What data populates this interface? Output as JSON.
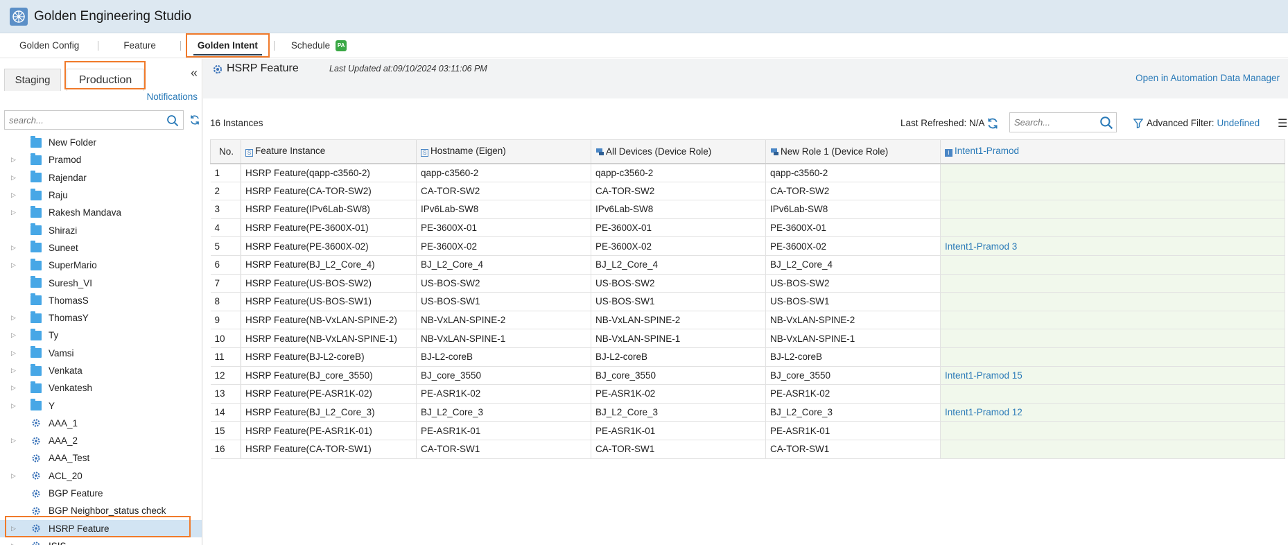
{
  "app": {
    "title": "Golden Engineering Studio"
  },
  "nav": {
    "tabs": [
      {
        "label": "Golden Config"
      },
      {
        "label": "Feature"
      },
      {
        "label": "Golden Intent",
        "active": true
      },
      {
        "label": "Schedule",
        "badge": "PA"
      }
    ]
  },
  "left": {
    "tabs": [
      {
        "label": "Staging"
      },
      {
        "label": "Production",
        "active": true
      }
    ],
    "notifications": "Notifications",
    "search_placeholder": "search...",
    "tree": [
      {
        "label": "New Folder",
        "icon": "folder-icon",
        "expandable": false
      },
      {
        "label": "Pramod",
        "icon": "folder-icon",
        "expandable": true
      },
      {
        "label": "Rajendar",
        "icon": "folder-icon",
        "expandable": true
      },
      {
        "label": "Raju",
        "icon": "folder-icon",
        "expandable": true
      },
      {
        "label": "Rakesh Mandava",
        "icon": "folder-icon",
        "expandable": true
      },
      {
        "label": "Shirazi",
        "icon": "folder-icon",
        "expandable": false
      },
      {
        "label": "Suneet",
        "icon": "folder-icon",
        "expandable": true
      },
      {
        "label": "SuperMario",
        "icon": "folder-icon",
        "expandable": true
      },
      {
        "label": "Suresh_VI",
        "icon": "folder-icon",
        "expandable": false
      },
      {
        "label": "ThomasS",
        "icon": "folder-icon",
        "expandable": false
      },
      {
        "label": "ThomasY",
        "icon": "folder-icon",
        "expandable": true
      },
      {
        "label": "Ty",
        "icon": "folder-icon",
        "expandable": true
      },
      {
        "label": "Vamsi",
        "icon": "folder-icon",
        "expandable": true
      },
      {
        "label": "Venkata",
        "icon": "folder-icon",
        "expandable": true
      },
      {
        "label": "Venkatesh",
        "icon": "folder-icon",
        "expandable": true
      },
      {
        "label": "Y",
        "icon": "folder-icon",
        "expandable": true
      },
      {
        "label": "AAA_1",
        "icon": "feature-icon",
        "expandable": false
      },
      {
        "label": "AAA_2",
        "icon": "feature-icon",
        "expandable": true
      },
      {
        "label": "AAA_Test",
        "icon": "feature-icon",
        "expandable": false
      },
      {
        "label": "ACL_20",
        "icon": "feature-icon",
        "expandable": true
      },
      {
        "label": "BGP Feature",
        "icon": "feature-icon",
        "expandable": false
      },
      {
        "label": "BGP Neighbor_status check",
        "icon": "feature-icon",
        "expandable": false
      },
      {
        "label": "HSRP Feature",
        "icon": "feature-icon",
        "expandable": true,
        "selected": true
      },
      {
        "label": "ISIS",
        "icon": "feature-icon",
        "expandable": true
      }
    ]
  },
  "main": {
    "title": "HSRP Feature",
    "last_updated": "Last Updated at:09/10/2024 03:11:06 PM",
    "open_adm": "Open in Automation Data Manager",
    "instances": "16 Instances",
    "last_refreshed": "Last Refreshed: N/A",
    "search_placeholder": "Search...",
    "adv_filter_label": "Advanced Filter:",
    "adv_filter_value": "Undefined",
    "columns": [
      {
        "label": "No."
      },
      {
        "label": "Feature Instance",
        "icon": "S"
      },
      {
        "label": "Hostname (Eigen)",
        "icon": "S"
      },
      {
        "label": "All Devices (Device Role)",
        "icon": "device-icon"
      },
      {
        "label": "New Role 1 (Device Role)",
        "icon": "device-icon"
      },
      {
        "label": "Intent1-Pramod",
        "icon": "I"
      }
    ],
    "rows": [
      {
        "no": "1",
        "instance": "HSRP Feature(qapp-c3560-2)",
        "host": "qapp-c3560-2",
        "all": "qapp-c3560-2",
        "role": "qapp-c3560-2",
        "intent": ""
      },
      {
        "no": "2",
        "instance": "HSRP Feature(CA-TOR-SW2)",
        "host": "CA-TOR-SW2",
        "all": "CA-TOR-SW2",
        "role": "CA-TOR-SW2",
        "intent": ""
      },
      {
        "no": "3",
        "instance": "HSRP Feature(IPv6Lab-SW8)",
        "host": "IPv6Lab-SW8",
        "all": "IPv6Lab-SW8",
        "role": "IPv6Lab-SW8",
        "intent": ""
      },
      {
        "no": "4",
        "instance": "HSRP Feature(PE-3600X-01)",
        "host": "PE-3600X-01",
        "all": "PE-3600X-01",
        "role": "PE-3600X-01",
        "intent": ""
      },
      {
        "no": "5",
        "instance": "HSRP Feature(PE-3600X-02)",
        "host": "PE-3600X-02",
        "all": "PE-3600X-02",
        "role": "PE-3600X-02",
        "intent": "Intent1-Pramod 3"
      },
      {
        "no": "6",
        "instance": "HSRP Feature(BJ_L2_Core_4)",
        "host": "BJ_L2_Core_4",
        "all": "BJ_L2_Core_4",
        "role": "BJ_L2_Core_4",
        "intent": ""
      },
      {
        "no": "7",
        "instance": "HSRP Feature(US-BOS-SW2)",
        "host": "US-BOS-SW2",
        "all": "US-BOS-SW2",
        "role": "US-BOS-SW2",
        "intent": ""
      },
      {
        "no": "8",
        "instance": "HSRP Feature(US-BOS-SW1)",
        "host": "US-BOS-SW1",
        "all": "US-BOS-SW1",
        "role": "US-BOS-SW1",
        "intent": ""
      },
      {
        "no": "9",
        "instance": "HSRP Feature(NB-VxLAN-SPINE-2)",
        "host": "NB-VxLAN-SPINE-2",
        "all": "NB-VxLAN-SPINE-2",
        "role": "NB-VxLAN-SPINE-2",
        "intent": ""
      },
      {
        "no": "10",
        "instance": "HSRP Feature(NB-VxLAN-SPINE-1)",
        "host": "NB-VxLAN-SPINE-1",
        "all": "NB-VxLAN-SPINE-1",
        "role": "NB-VxLAN-SPINE-1",
        "intent": ""
      },
      {
        "no": "11",
        "instance": "HSRP Feature(BJ-L2-coreB)",
        "host": "BJ-L2-coreB",
        "all": "BJ-L2-coreB",
        "role": "BJ-L2-coreB",
        "intent": ""
      },
      {
        "no": "12",
        "instance": "HSRP Feature(BJ_core_3550)",
        "host": "BJ_core_3550",
        "all": "BJ_core_3550",
        "role": "BJ_core_3550",
        "intent": "Intent1-Pramod 15"
      },
      {
        "no": "13",
        "instance": "HSRP Feature(PE-ASR1K-02)",
        "host": "PE-ASR1K-02",
        "all": "PE-ASR1K-02",
        "role": "PE-ASR1K-02",
        "intent": ""
      },
      {
        "no": "14",
        "instance": "HSRP Feature(BJ_L2_Core_3)",
        "host": "BJ_L2_Core_3",
        "all": "BJ_L2_Core_3",
        "role": "BJ_L2_Core_3",
        "intent": "Intent1-Pramod 12"
      },
      {
        "no": "15",
        "instance": "HSRP Feature(PE-ASR1K-01)",
        "host": "PE-ASR1K-01",
        "all": "PE-ASR1K-01",
        "role": "PE-ASR1K-01",
        "intent": ""
      },
      {
        "no": "16",
        "instance": "HSRP Feature(CA-TOR-SW1)",
        "host": "CA-TOR-SW1",
        "all": "CA-TOR-SW1",
        "role": "CA-TOR-SW1",
        "intent": ""
      }
    ]
  },
  "colors": {
    "accent": "#2a7ab8",
    "highlight": "#f07a2a",
    "header_bg": "#dde8f1",
    "intent_bg": "#f1f8ec",
    "selected_row": "#d2e4f3"
  }
}
